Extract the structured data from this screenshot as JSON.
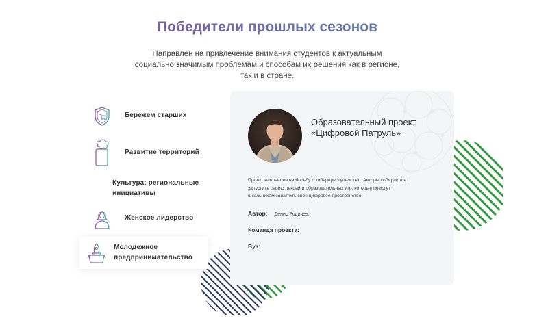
{
  "header": {
    "title": "Победители прошлых сезонов",
    "subtitle": "Направлен на привлечение внимания студентов к актуальным социально значимым проблемам и способам  их решения как в регионе, так и в стране."
  },
  "categories": [
    {
      "label": "Бережем старших",
      "icon": "shield-cart-icon"
    },
    {
      "label": "Развитие территорий",
      "icon": "scroll-tree-icon"
    },
    {
      "label": "Культура: региональные инициативы",
      "icon": ""
    },
    {
      "label": "Женское лидерство",
      "icon": "woman-icon"
    },
    {
      "label": "Молодежное предпринимательство",
      "icon": "rocket-box-icon",
      "active": true
    }
  ],
  "project": {
    "title": "Образовательный проект «Цифровой Патруль»",
    "description": "Проект направлен на борьбу с киберпреступностью. Авторы собираются запустить серию лекций и образовательных игр, которые помогут школьникам защитить свое цифровое пространство.",
    "author_label": "Автор:",
    "author_value": "Денис Родичев.",
    "team_label": "Команда проекта:",
    "university_label": "Вуз:"
  },
  "colors": {
    "title_gradient_start": "#8a4f9e",
    "title_gradient_end": "#5a8e9a",
    "stripe_green": "#2e9a3c",
    "stripe_navy": "#2d3560",
    "card_bg": "#f4f5f7"
  }
}
